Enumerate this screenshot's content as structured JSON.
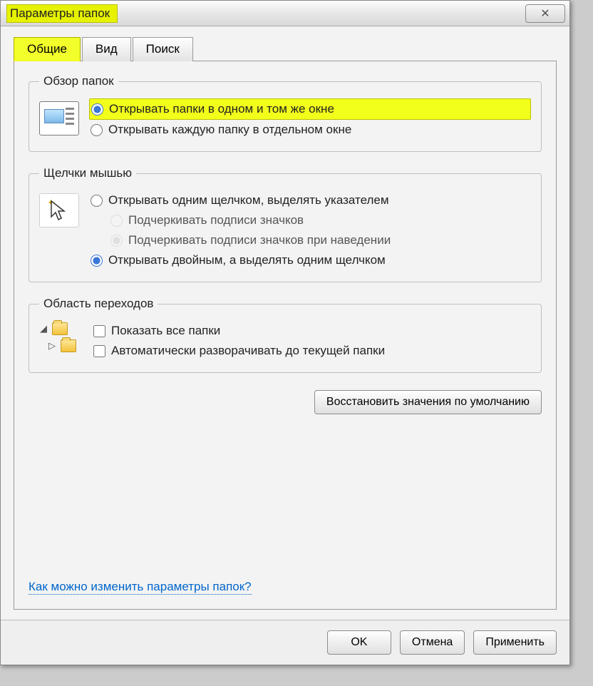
{
  "window": {
    "title": "Параметры папок"
  },
  "tabs": {
    "general": "Общие",
    "view": "Вид",
    "search": "Поиск"
  },
  "group_browse": {
    "legend": "Обзор папок",
    "opt_same_window": "Открывать папки в одном и том же окне",
    "opt_new_window": "Открывать каждую папку в отдельном окне"
  },
  "group_click": {
    "legend": "Щелчки мышью",
    "opt_single": "Открывать одним щелчком, выделять указателем",
    "opt_underline_always": "Подчеркивать подписи значков",
    "opt_underline_hover": "Подчеркивать подписи значков при наведении",
    "opt_double": "Открывать двойным, а выделять одним щелчком"
  },
  "group_nav": {
    "legend": "Область переходов",
    "opt_show_all": "Показать все папки",
    "opt_auto_expand": "Автоматически разворачивать до текущей папки"
  },
  "buttons": {
    "restore": "Восстановить значения по умолчанию",
    "ok": "OK",
    "cancel": "Отмена",
    "apply": "Применить"
  },
  "help_link": "Как можно изменить параметры папок?"
}
